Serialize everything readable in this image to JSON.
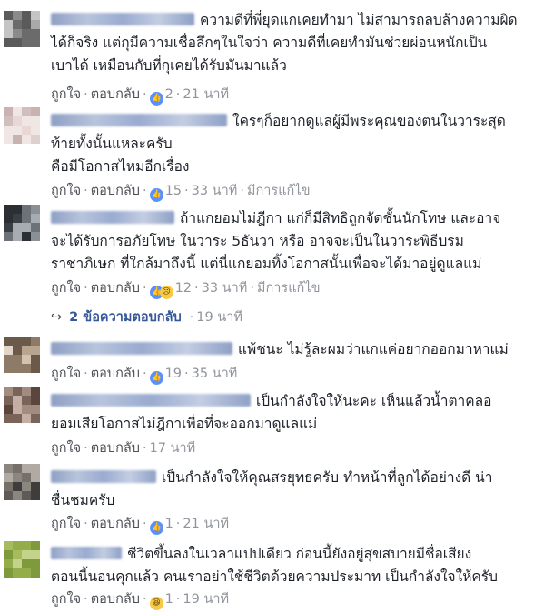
{
  "comments": [
    {
      "id": "c1",
      "name_blur_width": 1,
      "lines": [
        "ความดีที่พี่ยุดแกเคยทำมา ไม่สามารถลบล้างความผิด",
        "ได้ก็จริง แต่กุมีความเชื่อลึกๆในใจว่า ความดีที่เคยทำมันช่วยผ่อนหนักเป็น",
        "เบาได้ เหมือนกับที่กุเคยได้รับมันมาแล้ว"
      ],
      "like_label": "ถูกใจ",
      "reply_label": "ตอบกลับ",
      "reactions": [
        "like"
      ],
      "reaction_count": "2",
      "time": "21 นาที",
      "edited": ""
    },
    {
      "id": "c2",
      "lines": [
        "ใครๆก็อยากดูแลผู้มีพระคุณของตนในวาระสุด",
        "ท้ายทั้งนั้นแหละครับ",
        "คือมีโอกาสไหมอีกเรื่อง"
      ],
      "like_label": "ถูกใจ",
      "reply_label": "ตอบกลับ",
      "reactions": [
        "like"
      ],
      "reaction_count": "15",
      "time": "33 นาที",
      "edited": "มีการแก้ไข"
    },
    {
      "id": "c3",
      "lines": [
        "ถ้าแกยอมไม่ฎีกา แก่ก็มีสิทธิถูกจัดชั้นนักโทษ และอาจ",
        "จะได้รับการอภัยโทษ ในวาระ 5ธันวา หรือ อาจจะเป็นในวาระพิธีบรม",
        "ราชาภิเษก ที่ใกล้มาถึงนี้ แต่นี่แกยอมทิ้งโอกาสนั้นเพื่อจะได้มาอยู่ดูแลแม่"
      ],
      "like_label": "ถูกใจ",
      "reply_label": "ตอบกลับ",
      "reactions": [
        "like",
        "sad"
      ],
      "reaction_count": "12",
      "time": "33 นาที",
      "edited": "มีการแก้ไข"
    },
    {
      "id": "c4",
      "lines": [
        "แพ้ชนะ ไม่รู้ละผมว่าแกแค่อยากออกมาหาแม่"
      ],
      "like_label": "ถูกใจ",
      "reply_label": "ตอบกลับ",
      "reactions": [
        "like"
      ],
      "reaction_count": "19",
      "time": "35 นาที",
      "edited": ""
    },
    {
      "id": "c5",
      "lines": [
        "เป็นกำลังใจให้นะคะ เห็นแล้วน้ำตาคลอ",
        "ยอมเสียโอกาสไม่ฎีกาเพื่อที่จะออกมาดูแลแม่"
      ],
      "like_label": "ถูกใจ",
      "reply_label": "ตอบกลับ",
      "reactions": [],
      "reaction_count": "",
      "time": "17 นาที",
      "edited": ""
    },
    {
      "id": "c6",
      "lines": [
        "เป็นกำลังใจให้คุณสรยุทธครับ ทำหน้าที่ลูกได้อย่างดี น่า",
        "ชื่นชมครับ"
      ],
      "like_label": "ถูกใจ",
      "reply_label": "ตอบกลับ",
      "reactions": [
        "like"
      ],
      "reaction_count": "1",
      "time": "21 นาที",
      "edited": ""
    },
    {
      "id": "c7",
      "lines": [
        "ชีวิตขึ้นลงในเวลาแปปเดียว ก่อนนี้ยังอยู่สุขสบายมีชื่อเสียง",
        "ตอนนี้นอนคุกแล้ว คนเราอย่าใช้ชีวิตด้วยความประมาท เป็นกำลังใจให้ครับ"
      ],
      "like_label": "ถูกใจ",
      "reply_label": "ตอบกลับ",
      "reactions": [
        "haha"
      ],
      "reaction_count": "1",
      "time": "19 นาที",
      "edited": ""
    }
  ],
  "replies_link": {
    "label": "2 ข้อความตอบกลับ",
    "time": "19 นาที"
  },
  "colors": {
    "link": "#365899",
    "meta": "#90949c",
    "text": "#1d2129",
    "like_blue": "#5890ff"
  }
}
